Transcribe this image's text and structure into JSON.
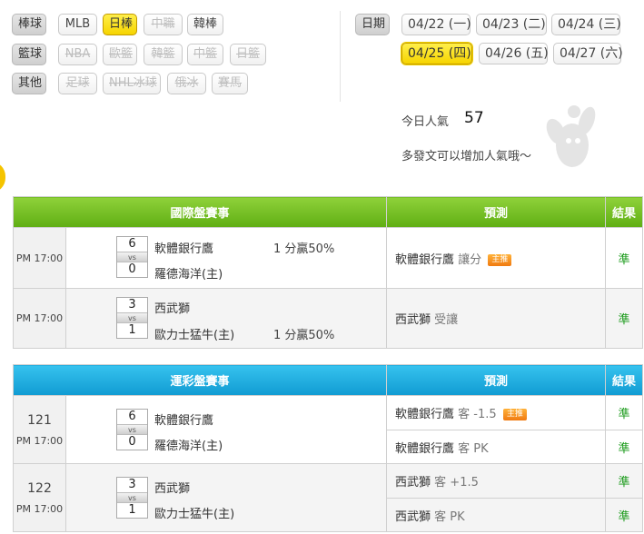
{
  "filters": {
    "baseball_label": "棒球",
    "baseball": [
      {
        "label": "MLB",
        "state": "normal"
      },
      {
        "label": "日棒",
        "state": "active"
      },
      {
        "label": "中職",
        "state": "disabled"
      },
      {
        "label": "韓棒",
        "state": "normal"
      }
    ],
    "basketball_label": "籃球",
    "basketball": [
      {
        "label": "NBA",
        "state": "disabled"
      },
      {
        "label": "歐籃",
        "state": "disabled"
      },
      {
        "label": "韓籃",
        "state": "disabled"
      },
      {
        "label": "中籃",
        "state": "disabled"
      },
      {
        "label": "日籃",
        "state": "disabled"
      }
    ],
    "other_label": "其他",
    "other": [
      {
        "label": "足球",
        "state": "disabled"
      },
      {
        "label": "NHL冰球",
        "state": "disabled"
      },
      {
        "label": "俄冰",
        "state": "disabled"
      },
      {
        "label": "賽馬",
        "state": "disabled"
      }
    ]
  },
  "dates": {
    "label": "日期",
    "items": [
      "04/22 (一)",
      "04/23 (二)",
      "04/24 (三)",
      "04/25 (四)",
      "04/26 (五)",
      "04/27 (六)"
    ],
    "active_index": 3
  },
  "popularity": {
    "label": "今日人氣",
    "value": "57",
    "hint": "多發文可以增加人氣哦～"
  },
  "intl": {
    "header": {
      "event": "國際盤賽事",
      "predict": "預測",
      "result": "結果"
    },
    "rows": [
      {
        "time": "PM 17:00",
        "score_away": "6",
        "score_home": "0",
        "vs": "vs",
        "team_away": "軟體銀行鷹",
        "team_home": "羅德海洋(主)",
        "odds": "1 分贏50%",
        "pick": "軟體銀行鷹",
        "pick_type": "讓分",
        "badge": "主推",
        "result": "準"
      },
      {
        "time": "PM 17:00",
        "score_away": "3",
        "score_home": "1",
        "vs": "vs",
        "team_away": "西武獅",
        "team_home": "歐力士猛牛(主)",
        "odds": "1 分贏50%",
        "pick": "西武獅",
        "pick_type": "受讓",
        "badge": "",
        "result": "準"
      }
    ]
  },
  "sports_lottery": {
    "header": {
      "event": "運彩盤賽事",
      "predict": "預測",
      "result": "結果"
    },
    "rows": [
      {
        "code": "121",
        "time": "PM 17:00",
        "score_away": "6",
        "score_home": "0",
        "vs": "vs",
        "team_away": "軟體銀行鷹",
        "team_home": "羅德海洋(主)",
        "picks": [
          {
            "team": "軟體銀行鷹",
            "type": "客 -1.5",
            "badge": "主推",
            "result": "準"
          },
          {
            "team": "軟體銀行鷹",
            "type": "客 PK",
            "badge": "",
            "result": "準"
          }
        ]
      },
      {
        "code": "122",
        "time": "PM 17:00",
        "score_away": "3",
        "score_home": "1",
        "vs": "vs",
        "team_away": "西武獅",
        "team_home": "歐力士猛牛(主)",
        "picks": [
          {
            "team": "西武獅",
            "type": "客 +1.5",
            "badge": "",
            "result": "準"
          },
          {
            "team": "西武獅",
            "type": "客 PK",
            "badge": "",
            "result": "準"
          }
        ]
      }
    ]
  },
  "colors": {
    "intl_header": "#6bb71d",
    "lottery_header": "#1aa7dc",
    "active_tag": "#f6d400",
    "result_text": "#1a9a1a",
    "badge": "#f07a10"
  }
}
